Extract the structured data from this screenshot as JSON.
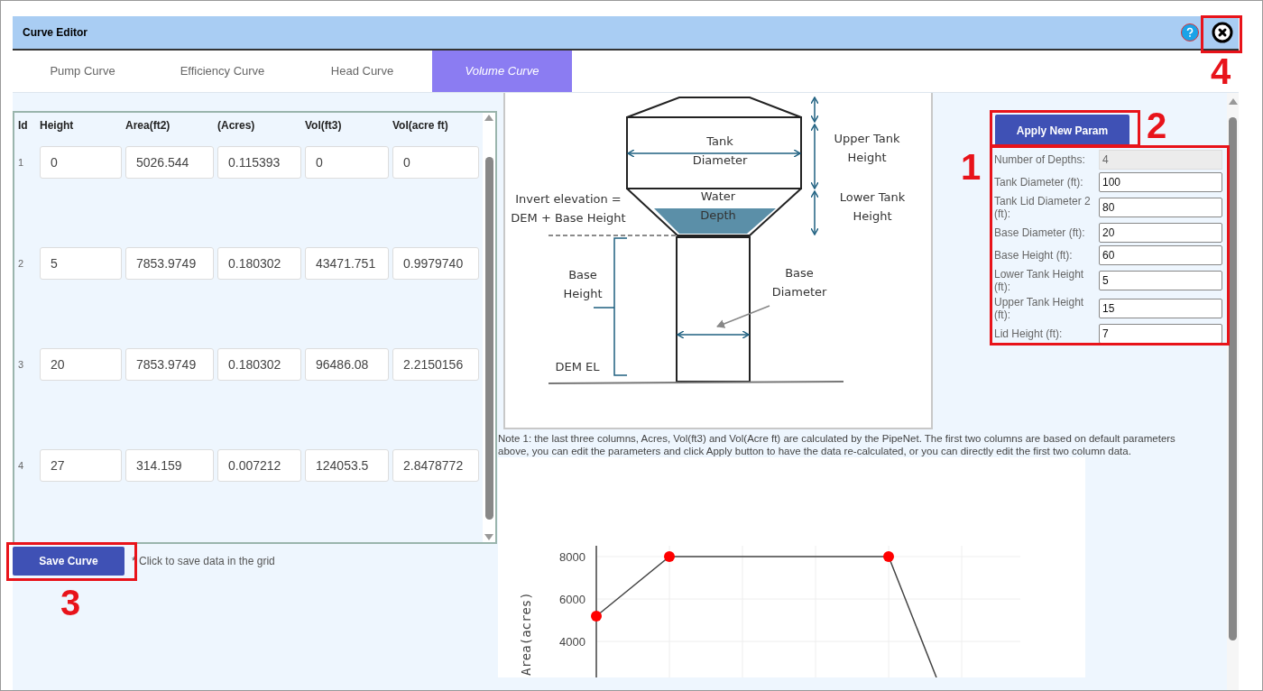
{
  "window": {
    "title": "Curve Editor"
  },
  "tabs": [
    {
      "label": "Pump Curve",
      "selected": false
    },
    {
      "label": "Efficiency Curve",
      "selected": false
    },
    {
      "label": "Head Curve",
      "selected": false
    },
    {
      "label": "Volume Curve",
      "selected": true
    }
  ],
  "grid": {
    "columns": [
      "Id",
      "Height",
      "Area(ft2)",
      "(Acres)",
      "Vol(ft3)",
      "Vol(acre ft)"
    ],
    "rows": [
      {
        "cells": [
          "1",
          "0",
          "5026.544",
          "0.115393",
          "0",
          "0"
        ]
      },
      {
        "cells": [
          "2",
          "5",
          "7853.9749",
          "0.180302",
          "43471.751",
          "0.9979740"
        ]
      },
      {
        "cells": [
          "3",
          "20",
          "7853.9749",
          "0.180302",
          "96486.08",
          "2.2150156"
        ]
      },
      {
        "cells": [
          "4",
          "27",
          "314.159",
          "0.007212",
          "124053.5",
          "2.8478772"
        ]
      }
    ]
  },
  "save_button": "Save Curve",
  "save_hint": "* Click to save data in the grid",
  "diagram": {
    "labels": [
      {
        "lines": [
          "Tank",
          "Diameter"
        ]
      },
      {
        "lines": [
          "Upper Tank",
          "Height"
        ]
      },
      {
        "lines": [
          "Invert elevation =",
          "DEM + Base Height"
        ]
      },
      {
        "lines": [
          "Water",
          "Depth"
        ]
      },
      {
        "lines": [
          "Lower Tank",
          "Height"
        ]
      },
      {
        "lines": [
          "Base",
          "Height"
        ]
      },
      {
        "lines": [
          "Base",
          "Diameter"
        ]
      },
      {
        "lines": [
          "DEM EL"
        ]
      }
    ]
  },
  "params": {
    "apply_button": "Apply New Param",
    "fields": [
      {
        "label": "Number of Depths:",
        "value": "4",
        "disabled": true
      },
      {
        "label": "Tank Diameter (ft):",
        "value": "100",
        "disabled": false
      },
      {
        "label": "Tank Lid Diameter 2 (ft):",
        "value": "80",
        "disabled": false
      },
      {
        "label": "Base Diameter (ft):",
        "value": "20",
        "disabled": false
      },
      {
        "label": "Base Height (ft):",
        "value": "60",
        "disabled": false
      },
      {
        "label": "Lower Tank Height (ft):",
        "value": "5",
        "disabled": false
      },
      {
        "label": "Upper Tank Height (ft):",
        "value": "15",
        "disabled": false
      },
      {
        "label": "Lid Height (ft):",
        "value": "7",
        "disabled": false
      }
    ]
  },
  "note": "Note 1: the last three columns, Acres, Vol(ft3) and Vol(Acre ft) are calculated by the PipeNet. The first two columns are based on default parameters above, you can edit the parameters and click Apply button to have the data re-calculated, or you can directly edit the first two column data.",
  "chart": {
    "ylabel": "Area(acres)",
    "ytick_labels": [
      "8000",
      "6000",
      "4000"
    ]
  },
  "annotations": [
    {
      "number": "1"
    },
    {
      "number": "2"
    },
    {
      "number": "3"
    },
    {
      "number": "4"
    }
  ]
}
